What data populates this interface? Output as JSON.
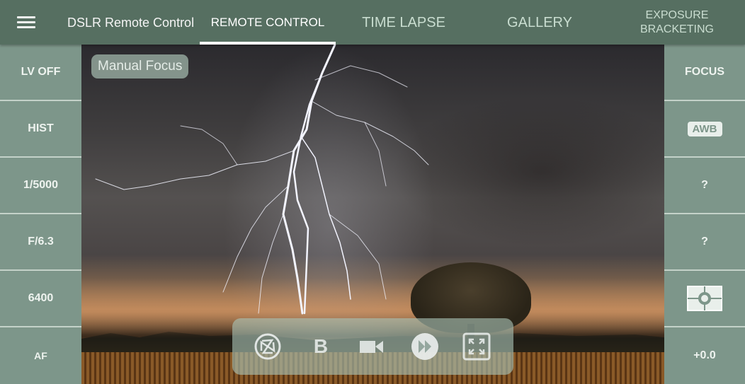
{
  "header": {
    "menu_icon": "hamburger-menu-icon",
    "app_title": "DSLR Remote Control",
    "tabs": [
      {
        "label": "REMOTE CONTROL",
        "active": true
      },
      {
        "label": "TIME LAPSE",
        "active": false
      },
      {
        "label": "GALLERY",
        "active": false
      },
      {
        "label": "EXPOSURE BRACKETING",
        "active": false
      }
    ]
  },
  "left_panel": {
    "items": [
      {
        "label": "LV OFF"
      },
      {
        "label": "HIST"
      },
      {
        "label": "1/5000"
      },
      {
        "label": "F/6.3"
      },
      {
        "label": "6400"
      },
      {
        "label": "AF"
      }
    ]
  },
  "right_panel": {
    "items": [
      {
        "label": "FOCUS"
      },
      {
        "label": "AWB",
        "icon": "awb-badge"
      },
      {
        "label": "?"
      },
      {
        "label": "?"
      },
      {
        "label": "",
        "icon": "metering-mode-icon"
      },
      {
        "label": "+0.0"
      }
    ]
  },
  "live_view": {
    "focus_mode_label": "Manual Focus",
    "controls": [
      {
        "name": "shutter-icon"
      },
      {
        "name": "bulb-mode",
        "label": "B"
      },
      {
        "name": "video-camera-icon"
      },
      {
        "name": "fast-forward-icon"
      },
      {
        "name": "fullscreen-icon"
      }
    ]
  },
  "colors": {
    "toolbar": "#566f61",
    "panel": "#7d968a",
    "divider": "#c4d2c9",
    "tab_active_text": "#ffffff",
    "tab_inactive_text": "#c9ddd0"
  }
}
